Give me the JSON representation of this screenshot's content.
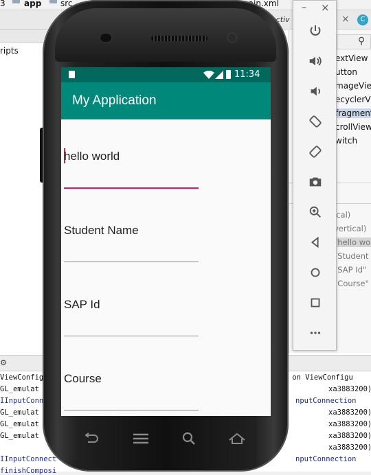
{
  "ide": {
    "breadcrumbs": [
      {
        "label": "3"
      },
      {
        "label": "app"
      },
      {
        "label": "src"
      },
      {
        "label": "main.xml"
      }
    ],
    "tab_partial": "activ",
    "left_panel_text": "ripts",
    "palette_items": [
      "extView",
      "utton",
      "mageView",
      "ecyclerView",
      "fragment>",
      "crollView",
      "witch"
    ],
    "tree_items": [
      "ical)",
      "vertical)",
      "\"hello wo",
      "\"Student",
      "\"SAP Id\"",
      "\"Course\""
    ],
    "console_left": [
      "ViewConfig",
      "GL_emulat",
      "IInputConn",
      "GL_emulat",
      "GL_emulat",
      "GL_emulat",
      "IInputConnect",
      "finishComposi"
    ],
    "console_right": [
      "t() on ViewConfigu",
      "xa3883200)",
      "nputConnection",
      "xa3883200)",
      "xa3883200)",
      "xa3883200)",
      "xa3883200)",
      "nputConnection"
    ]
  },
  "emulator": {
    "window_minimize": "–",
    "window_close": "×",
    "controls": [
      "power-icon",
      "volume-up-icon",
      "volume-down-icon",
      "rotate-left-icon",
      "rotate-right-icon",
      "camera-icon",
      "zoom-icon",
      "back-icon",
      "home-icon",
      "overview-icon",
      "more-icon"
    ]
  },
  "device": {
    "status_time": "11:34",
    "app_title": "My Application",
    "fields": [
      {
        "text": "hello world",
        "active": true
      },
      {
        "text": "Student Name",
        "active": false
      },
      {
        "text": "SAP Id",
        "active": false
      },
      {
        "text": "Course",
        "active": false
      }
    ]
  },
  "colors": {
    "status_bar": "#00695c",
    "app_bar": "#00897b",
    "accent": "#d81b60"
  }
}
